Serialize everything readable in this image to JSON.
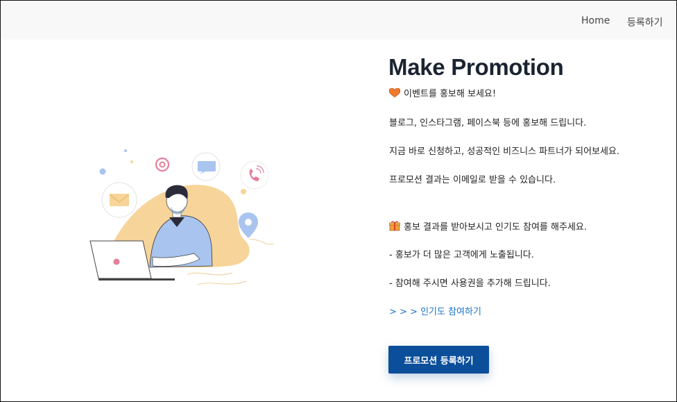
{
  "nav": {
    "home": "Home",
    "register": "등록하기"
  },
  "hero": {
    "title": "Make Promotion",
    "line1": "이벤트를 홍보해 보세요!",
    "line2": "블로그, 인스타그램, 페이스북 등에 홍보해 드립니다.",
    "line3": "지금 바로 신청하고, 성공적인 비즈니스 파트너가 되어보세요.",
    "line4": "프로모션 결과는 이메일로 받을 수 있습니다.",
    "line5": "홍보 결과를 받아보시고 인기도 참여를 해주세요.",
    "line6": "- 홍보가 더 많은 고객에게 노출됩니다.",
    "line7": "- 참여해 주시면 사용권을 추가해 드립니다.",
    "link": "> > > 인기도 참여하기",
    "cta": "프로모션 등록하기"
  },
  "icons": [
    "heart-icon",
    "gift-icon",
    "email-icon",
    "at-sign-icon",
    "chat-icon",
    "phone-icon",
    "location-pin-icon"
  ],
  "colors": {
    "cta": "#0b4e9a",
    "link": "#1a73c8",
    "heart": "#f07a2a",
    "navbar": "#f8f8f9",
    "illustration_blob": "#f6d49a",
    "shirt": "#a9c4ee"
  }
}
